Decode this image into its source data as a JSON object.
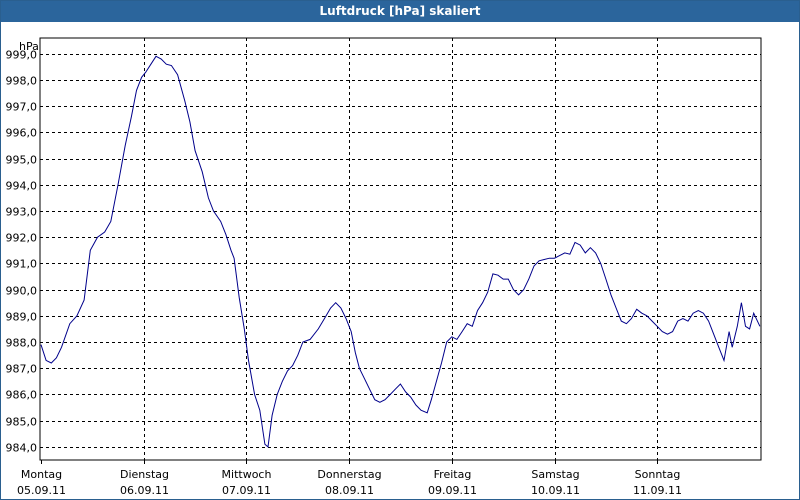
{
  "window": {
    "title": "Luftdruck [hPa] skaliert"
  },
  "chart_data": {
    "type": "line",
    "title": "Luftdruck [hPa] skaliert",
    "ylabel": "hPa",
    "xlabel": "",
    "ylim": [
      983.5,
      999.6
    ],
    "xlim": [
      0,
      7
    ],
    "yticks": [
      "984,0",
      "985,0",
      "986,0",
      "987,0",
      "988,0",
      "989,0",
      "990,0",
      "991,0",
      "992,0",
      "993,0",
      "994,0",
      "995,0",
      "996,0",
      "997,0",
      "998,0",
      "999,0"
    ],
    "xticks": [
      {
        "day": "Montag",
        "date": "05.09.11",
        "pos": 0
      },
      {
        "day": "Dienstag",
        "date": "06.09.11",
        "pos": 1
      },
      {
        "day": "Mittwoch",
        "date": "07.09.11",
        "pos": 2
      },
      {
        "day": "Donnerstag",
        "date": "08.09.11",
        "pos": 3
      },
      {
        "day": "Freitag",
        "date": "09.09.11",
        "pos": 4
      },
      {
        "day": "Samstag",
        "date": "10.09.11",
        "pos": 5
      },
      {
        "day": "Sonntag",
        "date": "11.09.11",
        "pos": 6
      }
    ],
    "grid": true,
    "series": [
      {
        "color": "#00008b",
        "points": [
          [
            0.0,
            987.9
          ],
          [
            0.05,
            987.3
          ],
          [
            0.1,
            987.2
          ],
          [
            0.15,
            987.4
          ],
          [
            0.2,
            987.8
          ],
          [
            0.28,
            988.7
          ],
          [
            0.35,
            989.0
          ],
          [
            0.42,
            989.6
          ],
          [
            0.48,
            991.5
          ],
          [
            0.55,
            992.0
          ],
          [
            0.62,
            992.2
          ],
          [
            0.68,
            992.6
          ],
          [
            0.75,
            994.0
          ],
          [
            0.82,
            995.5
          ],
          [
            0.88,
            996.6
          ],
          [
            0.93,
            997.6
          ],
          [
            0.98,
            998.1
          ],
          [
            1.02,
            998.3
          ],
          [
            1.07,
            998.6
          ],
          [
            1.12,
            998.9
          ],
          [
            1.17,
            998.8
          ],
          [
            1.22,
            998.6
          ],
          [
            1.27,
            998.55
          ],
          [
            1.33,
            998.2
          ],
          [
            1.4,
            997.2
          ],
          [
            1.45,
            996.4
          ],
          [
            1.5,
            995.3
          ],
          [
            1.57,
            994.5
          ],
          [
            1.63,
            993.5
          ],
          [
            1.68,
            993.0
          ],
          [
            1.75,
            992.6
          ],
          [
            1.8,
            992.1
          ],
          [
            1.85,
            991.5
          ],
          [
            1.88,
            991.2
          ],
          [
            1.93,
            989.7
          ],
          [
            1.98,
            988.5
          ],
          [
            2.02,
            987.3
          ],
          [
            2.08,
            986.0
          ],
          [
            2.13,
            985.4
          ],
          [
            2.18,
            984.1
          ],
          [
            2.21,
            984.0
          ],
          [
            2.25,
            985.2
          ],
          [
            2.3,
            986.0
          ],
          [
            2.35,
            986.5
          ],
          [
            2.4,
            986.9
          ],
          [
            2.45,
            987.1
          ],
          [
            2.5,
            987.5
          ],
          [
            2.55,
            988.0
          ],
          [
            2.62,
            988.1
          ],
          [
            2.7,
            988.5
          ],
          [
            2.76,
            988.9
          ],
          [
            2.82,
            989.3
          ],
          [
            2.87,
            989.5
          ],
          [
            2.92,
            989.3
          ],
          [
            2.97,
            988.9
          ],
          [
            3.02,
            988.4
          ],
          [
            3.06,
            987.6
          ],
          [
            3.1,
            987.0
          ],
          [
            3.15,
            986.6
          ],
          [
            3.2,
            986.2
          ],
          [
            3.25,
            985.8
          ],
          [
            3.3,
            985.7
          ],
          [
            3.35,
            985.8
          ],
          [
            3.4,
            986.0
          ],
          [
            3.45,
            986.2
          ],
          [
            3.5,
            986.4
          ],
          [
            3.55,
            986.1
          ],
          [
            3.6,
            985.9
          ],
          [
            3.65,
            985.6
          ],
          [
            3.7,
            985.4
          ],
          [
            3.76,
            985.3
          ],
          [
            3.8,
            985.8
          ],
          [
            3.85,
            986.5
          ],
          [
            3.9,
            987.2
          ],
          [
            3.95,
            988.0
          ],
          [
            4.0,
            988.2
          ],
          [
            4.05,
            988.1
          ],
          [
            4.1,
            988.4
          ],
          [
            4.15,
            988.7
          ],
          [
            4.2,
            988.6
          ],
          [
            4.25,
            989.2
          ],
          [
            4.3,
            989.5
          ],
          [
            4.35,
            989.9
          ],
          [
            4.4,
            990.6
          ],
          [
            4.45,
            990.55
          ],
          [
            4.5,
            990.4
          ],
          [
            4.55,
            990.4
          ],
          [
            4.6,
            990.0
          ],
          [
            4.65,
            989.8
          ],
          [
            4.7,
            990.0
          ],
          [
            4.75,
            990.4
          ],
          [
            4.8,
            990.9
          ],
          [
            4.85,
            991.1
          ],
          [
            4.9,
            991.15
          ],
          [
            4.95,
            991.2
          ],
          [
            5.0,
            991.2
          ],
          [
            5.05,
            991.3
          ],
          [
            5.1,
            991.4
          ],
          [
            5.15,
            991.35
          ],
          [
            5.2,
            991.8
          ],
          [
            5.25,
            991.7
          ],
          [
            5.3,
            991.4
          ],
          [
            5.35,
            991.6
          ],
          [
            5.4,
            991.4
          ],
          [
            5.45,
            991.0
          ],
          [
            5.5,
            990.4
          ],
          [
            5.55,
            989.8
          ],
          [
            5.6,
            989.3
          ],
          [
            5.65,
            988.8
          ],
          [
            5.7,
            988.7
          ],
          [
            5.75,
            988.9
          ],
          [
            5.8,
            989.25
          ],
          [
            5.85,
            989.1
          ],
          [
            5.9,
            989.0
          ],
          [
            5.95,
            988.8
          ],
          [
            6.0,
            988.6
          ],
          [
            6.05,
            988.4
          ],
          [
            6.1,
            988.3
          ],
          [
            6.15,
            988.4
          ],
          [
            6.2,
            988.8
          ],
          [
            6.25,
            988.9
          ],
          [
            6.3,
            988.8
          ],
          [
            6.35,
            989.1
          ],
          [
            6.4,
            989.2
          ],
          [
            6.45,
            989.1
          ],
          [
            6.5,
            988.8
          ],
          [
            6.55,
            988.3
          ],
          [
            6.6,
            987.8
          ],
          [
            6.65,
            987.3
          ],
          [
            6.7,
            988.4
          ],
          [
            6.73,
            987.8
          ],
          [
            6.78,
            988.6
          ],
          [
            6.82,
            989.5
          ],
          [
            6.86,
            988.6
          ],
          [
            6.9,
            988.5
          ],
          [
            6.94,
            989.1
          ],
          [
            7.0,
            988.6
          ]
        ]
      }
    ]
  }
}
